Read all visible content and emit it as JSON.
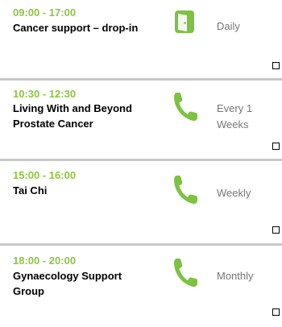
{
  "events": [
    {
      "time": "09:00 - 17:00",
      "title": "Cancer support – drop-in",
      "icon": "door-icon",
      "frequency": "Daily"
    },
    {
      "time": "10:30 - 12:30",
      "title": "Living With and Beyond Prostate Cancer",
      "icon": "phone-icon",
      "frequency": "Every 1 Weeks"
    },
    {
      "time": "15:00 - 16:00",
      "title": "Tai Chi",
      "icon": "phone-icon",
      "frequency": "Weekly"
    },
    {
      "time": "18:00 - 20:00",
      "title": "Gynaecology Support Group",
      "icon": "phone-icon",
      "frequency": "Monthly"
    }
  ],
  "colors": {
    "time_accent": "#8cc63f",
    "icon_green": "#7dc242",
    "frequency_text": "#777777",
    "divider": "#c8c8c8"
  }
}
